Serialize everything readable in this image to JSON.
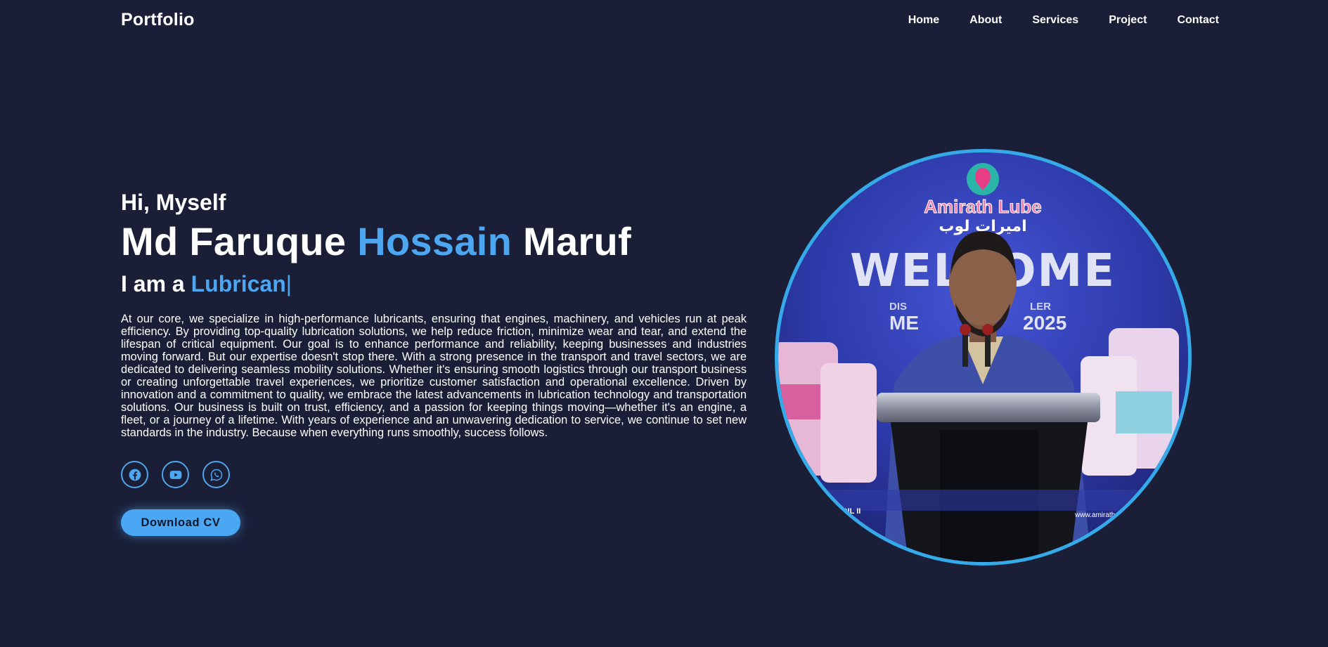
{
  "nav": {
    "logo": "Portfolio",
    "links": [
      "Home",
      "About",
      "Services",
      "Project",
      "Contact"
    ]
  },
  "hero": {
    "greeting": "Hi, Myself",
    "name_first": "Md Faruque",
    "name_middle": "Hossain",
    "name_last": "Maruf",
    "role_prefix": "I am a",
    "role_typed": "Lubrican",
    "cursor": "|",
    "description": "At our core, we specialize in high-performance lubricants, ensuring that engines, machinery, and vehicles run at peak efficiency. By providing top-quality lubrication solutions, we help reduce friction, minimize wear and tear, and extend the lifespan of critical equipment. Our goal is to enhance performance and reliability, keeping businesses and industries moving forward. But our expertise doesn't stop there. With a strong presence in the transport and travel sectors, we are dedicated to delivering seamless mobility solutions. Whether it's ensuring smooth logistics through our transport business or creating unforgettable travel experiences, we prioritize customer satisfaction and operational excellence. Driven by innovation and a commitment to quality, we embrace the latest advancements in lubrication technology and transportation solutions. Our business is built on trust, efficiency, and a passion for keeping things moving—whether it's an engine, a fleet, or a journey of a lifetime. With years of experience and an unwavering dedication to service, we continue to set new standards in the industry. Because when everything runs smoothly, success follows.",
    "socials": [
      {
        "icon": "facebook-icon"
      },
      {
        "icon": "youtube-icon"
      },
      {
        "icon": "whatsapp-icon"
      }
    ],
    "cv_button": "Download CV"
  },
  "photo": {
    "brand": "Amirath Lube",
    "brand_arabic": "اميرات لوب",
    "banner_word": "WELCOME",
    "banner_sub1": "DIS",
    "banner_sub2": "LER",
    "banner_line": "ME",
    "banner_year": "2025",
    "banner_bottom_left": "OIL II",
    "banner_url": "www.amirath"
  },
  "colors": {
    "background": "#1a1f37",
    "accent": "#4da6f0",
    "photo_border": "#36a9e8"
  }
}
